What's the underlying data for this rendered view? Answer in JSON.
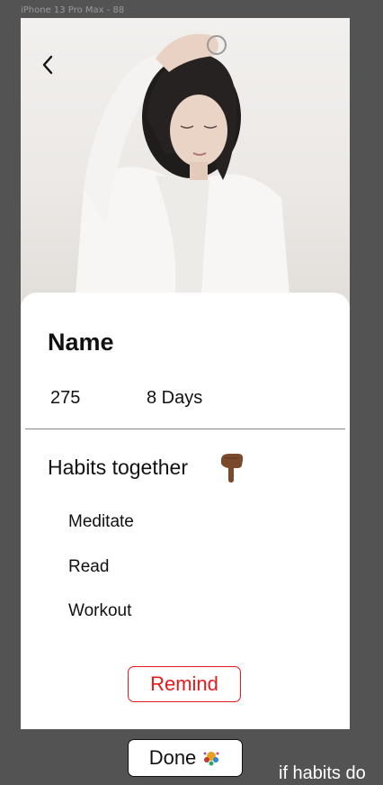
{
  "frame": {
    "label": "iPhone 13 Pro Max - 88"
  },
  "profile": {
    "name": "Name",
    "stats": [
      "275",
      "8 Days"
    ]
  },
  "habits": {
    "title": "Habits together",
    "icon": "pointing-down-hand-icon",
    "items": [
      "Meditate",
      "Read",
      "Workout"
    ]
  },
  "actions": {
    "remind_label": "Remind",
    "done_label": "Done"
  },
  "note": {
    "text": "if habits do"
  },
  "colors": {
    "background": "#535353",
    "accent_red": "#e8191b",
    "hand_icon": "#7a4a2c"
  }
}
